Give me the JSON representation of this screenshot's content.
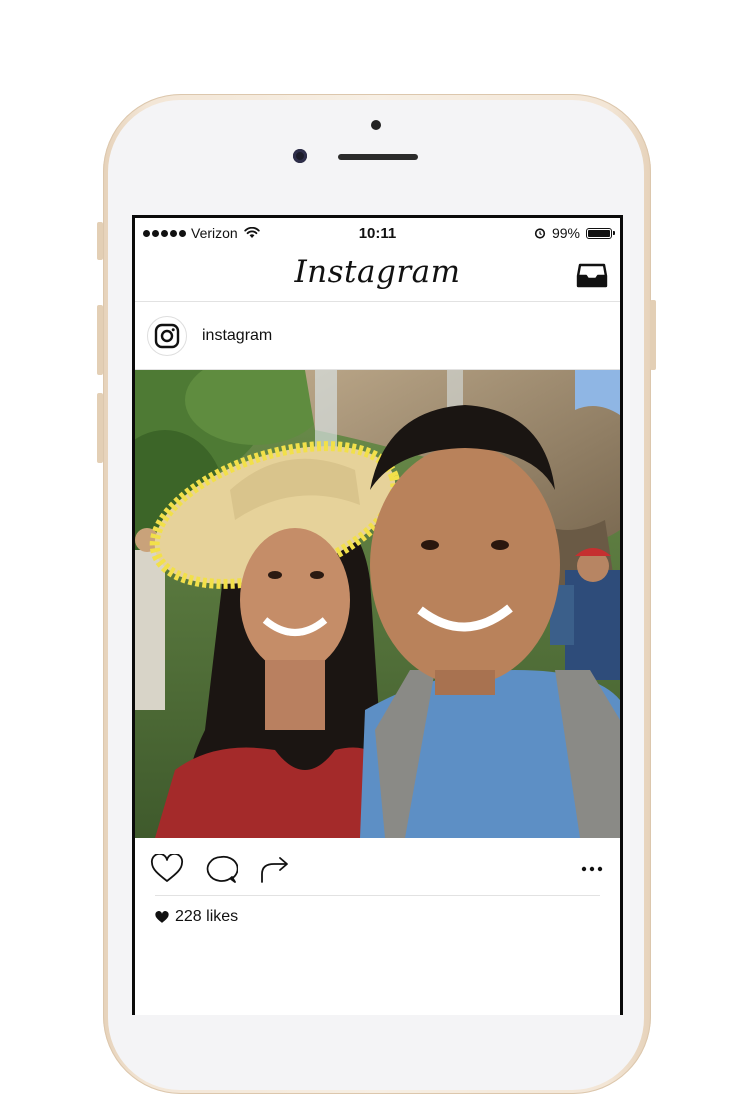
{
  "status_bar": {
    "carrier": "Verizon",
    "time": "10:11",
    "battery_percent": "99%",
    "battery_level": 0.99,
    "icons": [
      "signal-dots",
      "wifi-icon",
      "alarm-icon",
      "battery-icon"
    ]
  },
  "nav": {
    "logo_text": "Instagram",
    "right_icon": "inbox-icon"
  },
  "post": {
    "username": "instagram",
    "avatar_icon": "instagram-logo-icon",
    "likes_text": "228 likes",
    "actions": [
      "like-heart-icon",
      "comment-bubble-icon",
      "share-arrow-icon",
      "more-dots-icon"
    ]
  },
  "colors": {
    "phone_gold": "#f3e6d6",
    "text": "#111111",
    "divider": "#e2e2e2"
  }
}
